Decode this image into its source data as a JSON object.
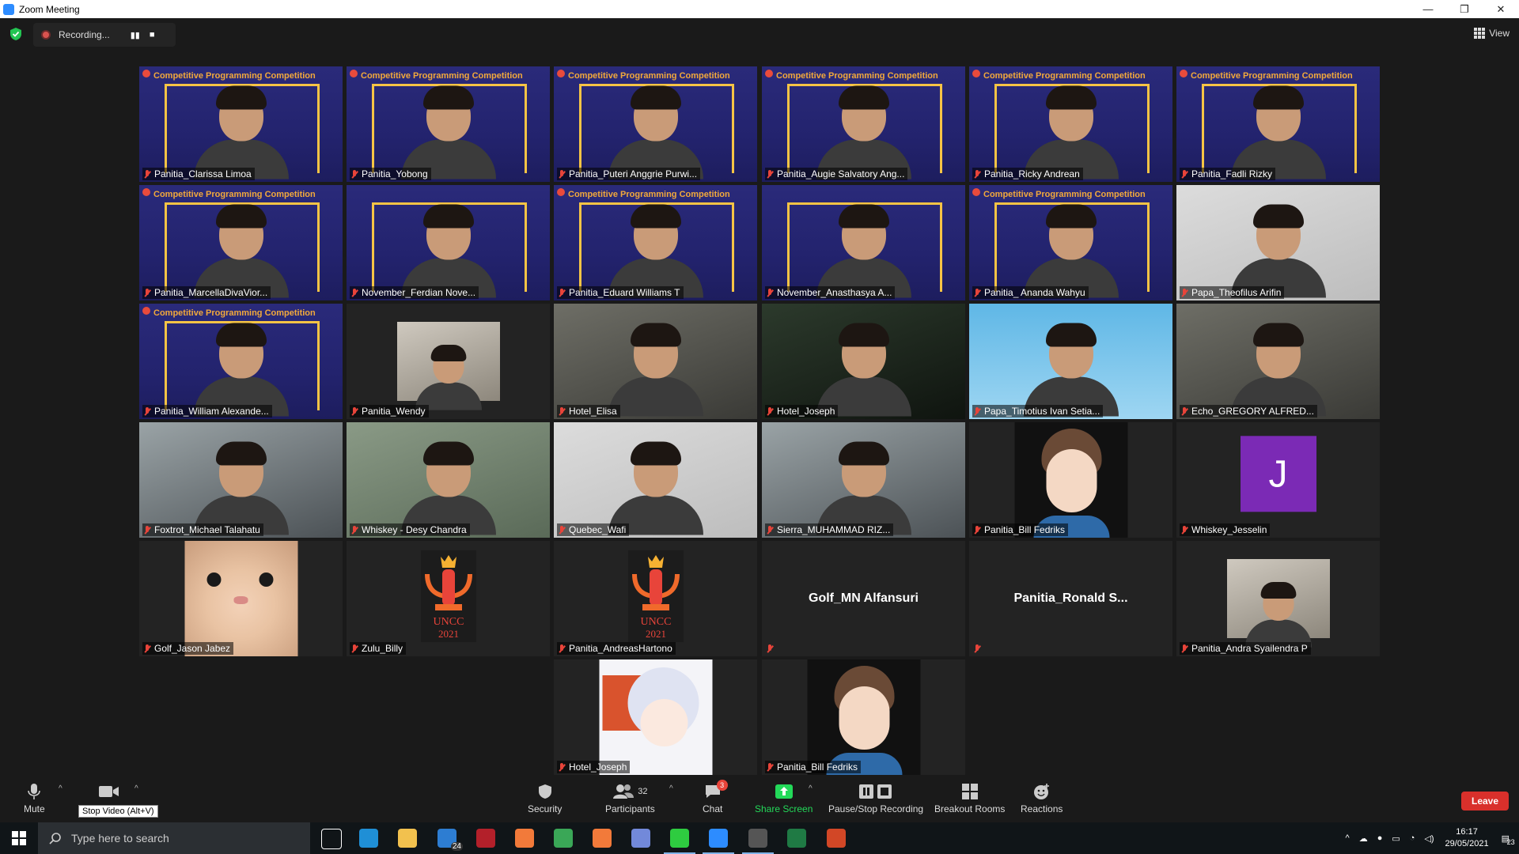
{
  "window": {
    "title": "Zoom Meeting",
    "minimize": "—",
    "restore": "❐",
    "close": "✕"
  },
  "topbar": {
    "recording_label": "Recording...",
    "pause_glyph": "▮▮",
    "stop_glyph": "■",
    "view_label": "View"
  },
  "banner_text": "Competitive Programming Competition",
  "participants": [
    {
      "name": "Panitia_Clarissa Limoa",
      "bg": "banner"
    },
    {
      "name": "Panitia_Yobong",
      "bg": "banner",
      "active": true
    },
    {
      "name": "Panitia_Puteri Anggrie Purwi...",
      "bg": "banner"
    },
    {
      "name": "Panitia_Augie Salvatory Ang...",
      "bg": "banner"
    },
    {
      "name": "Panitia_Ricky Andrean",
      "bg": "banner"
    },
    {
      "name": "Panitia_Fadli Rizky",
      "bg": "banner"
    },
    {
      "name": "Panitia_MarcellaDivaVior...",
      "bg": "banner"
    },
    {
      "name": "November_Ferdian Nove...",
      "bg": "banner2"
    },
    {
      "name": "Panitia_Eduard Williams T",
      "bg": "banner"
    },
    {
      "name": "November_Anasthasya A...",
      "bg": "banner2"
    },
    {
      "name": "Panitia_ Ananda Wahyu",
      "bg": "banner"
    },
    {
      "name": "Papa_Theofilus Arifin",
      "bg": "white"
    },
    {
      "name": "Panitia_William Alexande...",
      "bg": "banner"
    },
    {
      "name": "Panitia_Wendy",
      "bg": "sub"
    },
    {
      "name": "Hotel_Elisa",
      "bg": "plain"
    },
    {
      "name": "Hotel_Joseph",
      "bg": "dark"
    },
    {
      "name": "Papa_Timotius Ivan Setia...",
      "bg": "sea"
    },
    {
      "name": "Echo_GREGORY ALFRED...",
      "bg": "plain"
    },
    {
      "name": "Foxtrot_Michael Talahatu",
      "bg": "room"
    },
    {
      "name": "Whiskey - Desy Chandra",
      "bg": "green"
    },
    {
      "name": "Quebec_Wafi",
      "bg": "white"
    },
    {
      "name": "Sierra_MUHAMMAD RIZ...",
      "bg": "room"
    },
    {
      "name": "Panitia_Bill Fedriks",
      "bg": "avatar3d"
    },
    {
      "name": "Whiskey_Jesselin",
      "bg": "initial",
      "initial": "J"
    },
    {
      "name": "Golf_Jason Jabez",
      "bg": "cat"
    },
    {
      "name": "Zulu_Billy",
      "bg": "logo"
    },
    {
      "name": "Panitia_AndreasHartono",
      "bg": "logo"
    },
    {
      "name": "",
      "bg": "text",
      "display_name": "Golf_MN Alfansuri"
    },
    {
      "name": "",
      "bg": "text",
      "display_name": "Panitia_Ronald   S..."
    },
    {
      "name": "Panitia_Andra Syailendra P",
      "bg": "sub"
    },
    {
      "name": "Hotel_Joseph",
      "bg": "anime"
    },
    {
      "name": "Panitia_Bill Fedriks",
      "bg": "avatar3d"
    }
  ],
  "logo_text": {
    "top": "UNCC",
    "bottom": "2021"
  },
  "toolbar": {
    "mute": "Mute",
    "stop_video_tooltip": "Stop Video (Alt+V)",
    "security": "Security",
    "participants": "Participants",
    "participants_count": "32",
    "chat": "Chat",
    "chat_badge": "3",
    "share_screen": "Share Screen",
    "pause_stop_recording": "Pause/Stop Recording",
    "breakout_rooms": "Breakout Rooms",
    "reactions": "Reactions",
    "leave": "Leave",
    "share_color": "#23d959",
    "leave_color": "#d9302b"
  },
  "taskbar": {
    "search_placeholder": "Type here to search",
    "mail_badge": "24",
    "time": "16:17",
    "date": "29/05/2021",
    "notif_count": "23"
  }
}
